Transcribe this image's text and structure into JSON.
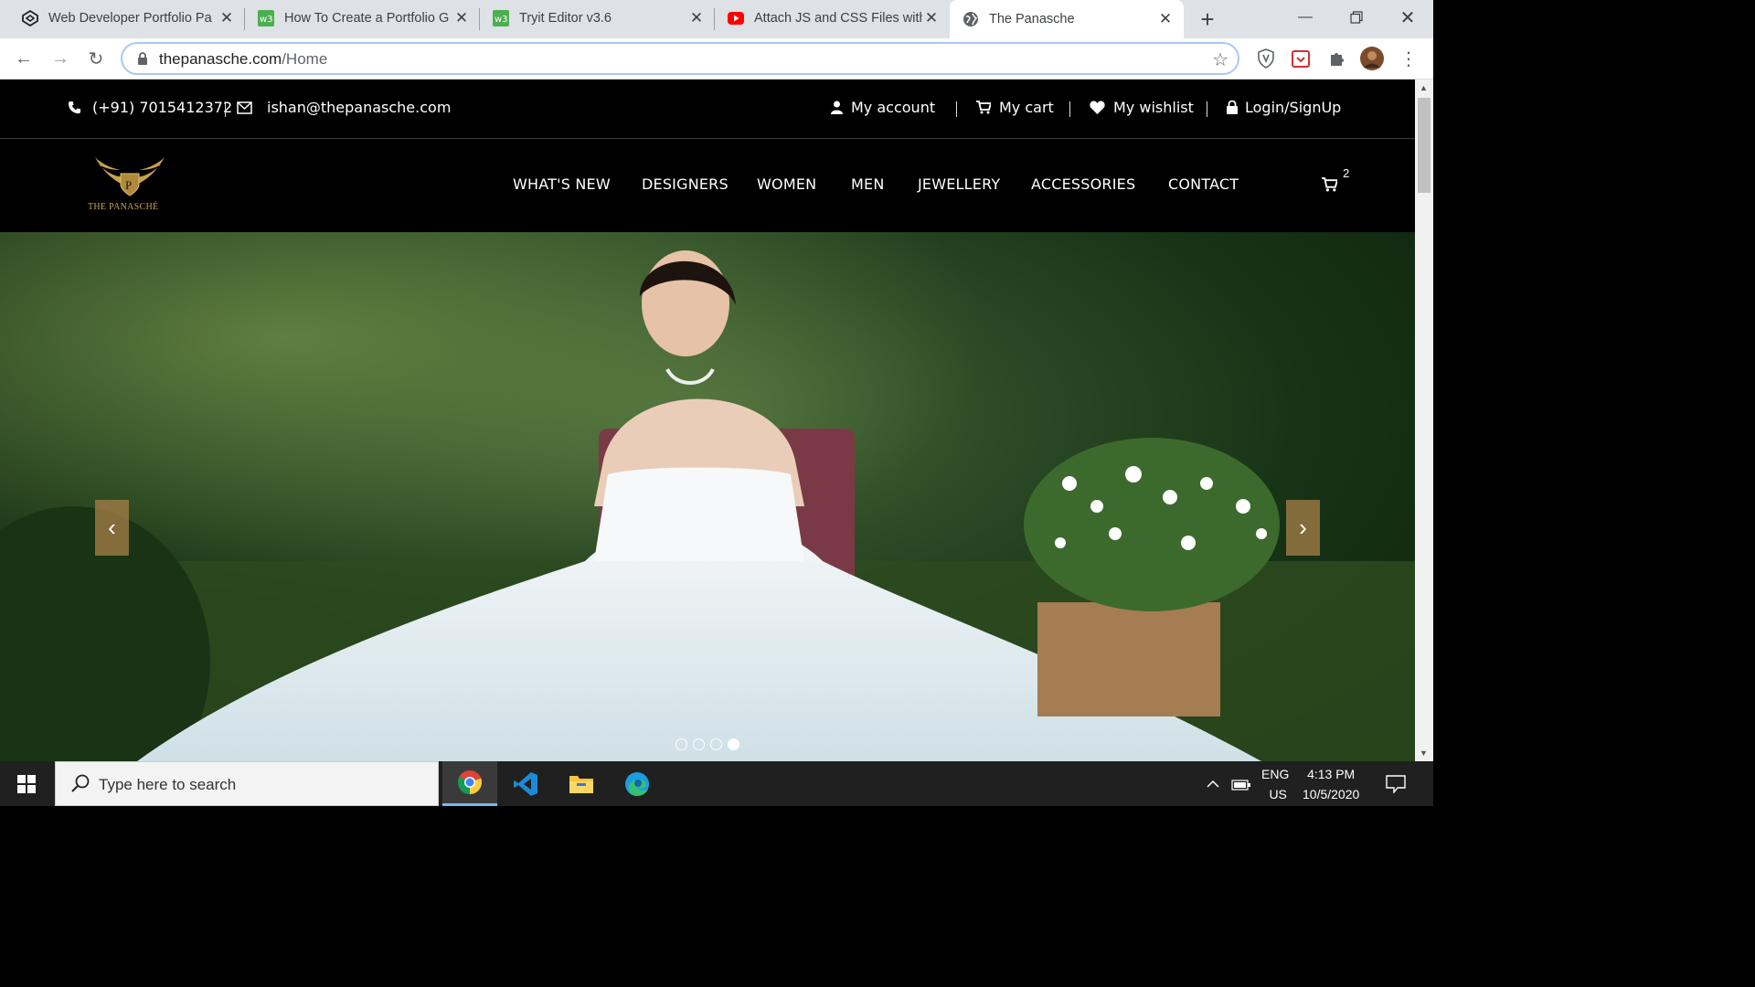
{
  "browser": {
    "tabs": [
      {
        "title": "Web Developer Portfolio Pa",
        "icon": "codepen-icon"
      },
      {
        "title": "How To Create a Portfolio G",
        "icon": "w3schools-icon"
      },
      {
        "title": "Tryit Editor v3.6",
        "icon": "w3schools-icon"
      },
      {
        "title": "Attach JS and CSS Files with",
        "icon": "youtube-icon"
      },
      {
        "title": "The Panasche",
        "icon": "globe-icon"
      }
    ],
    "url_host": "thepanasche.com",
    "url_path": "/Home"
  },
  "site": {
    "topbar": {
      "phone": "(+91) 7015412372",
      "email": "ishan@thepanasche.com",
      "links": [
        "My account",
        "My cart",
        "My wishlist",
        "Login/SignUp"
      ]
    },
    "logo_text": "THE PANASCHÉ",
    "nav": [
      "WHAT'S NEW",
      "DESIGNERS",
      "WOMEN",
      "MEN",
      "JEWELLERY",
      "ACCESSORIES",
      "CONTACT"
    ],
    "cart_count": "2",
    "slider": {
      "total": 4,
      "active": 4
    }
  },
  "taskbar": {
    "search_placeholder": "Type here to search",
    "lang_top": "ENG",
    "lang_bottom": "US",
    "time": "4:13 PM",
    "date": "10/5/2020"
  },
  "colors": {
    "gold": "#c8a24a",
    "page_bg": "#000000",
    "arrow_bg": "#a88048",
    "taskbar": "#202020"
  }
}
